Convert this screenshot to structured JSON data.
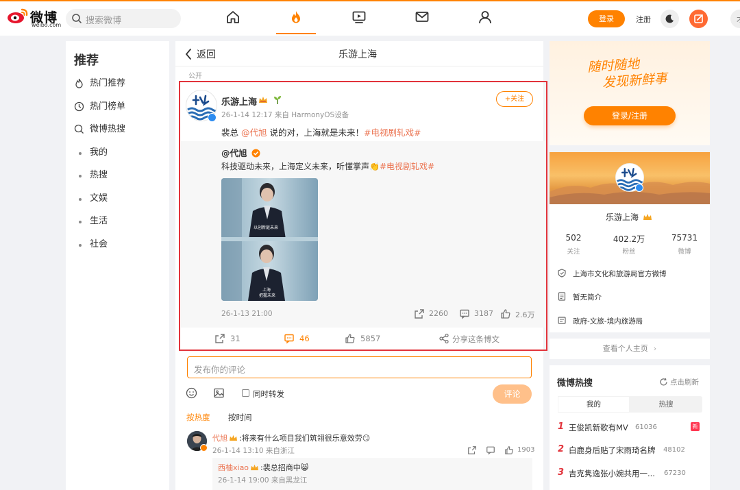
{
  "header": {
    "logo_text": "微博",
    "logo_sub": "weibo.com",
    "search_placeholder": "搜索微博",
    "nav": [
      "home-icon",
      "hot-icon",
      "video-icon",
      "message-icon",
      "profile-icon"
    ],
    "login_label": "登录",
    "register_label": "注册",
    "extra_label": "才"
  },
  "sidebar": {
    "title": "推荐",
    "items": [
      {
        "label": "热门推荐",
        "icon": "flame-icon"
      },
      {
        "label": "热门榜单",
        "icon": "clock-icon"
      },
      {
        "label": "微博热搜",
        "icon": "search-icon"
      },
      {
        "label": "我的"
      },
      {
        "label": "热搜"
      },
      {
        "label": "文娱"
      },
      {
        "label": "生活"
      },
      {
        "label": "社会"
      }
    ]
  },
  "main": {
    "back_label": "返回",
    "title": "乐游上海",
    "visibility": "公开",
    "post": {
      "author": "乐游上海",
      "meta": "26-1-14 12:17 来自 HarmonyOS设备",
      "follow_label": "+关注",
      "text_pre": "裴总 ",
      "text_mention": "@代旭",
      "text_mid": " 说的对，上海就是未来！",
      "text_topic": "#电视剧轧戏#",
      "repost": {
        "author": "@代旭",
        "text": "科技驱动未来，上海定义未来，听懂掌声👏",
        "topic": "#电视剧轧戏#",
        "time": "26-1-13 21:00",
        "reposts": "2260",
        "comments": "3187",
        "likes": "2.6万",
        "video_caption_1": "以创新驱未来",
        "video_caption_2": "上海",
        "video_caption_3": "把握未来"
      },
      "reposts": "31",
      "comments": "46",
      "likes": "5857",
      "share_label": "分享这条博文"
    },
    "comment_box": {
      "placeholder": "发布你的评论",
      "forward_label": "同时转发",
      "submit_label": "评论"
    },
    "sort": {
      "hot": "按热度",
      "time": "按时间"
    },
    "comments": [
      {
        "user": "代旭",
        "text": ":将来有什么项目我们筑翎很乐意效劳😏",
        "meta": "26-1-14 13:10 来自浙江",
        "likes": "1903",
        "reply": {
          "user": "西柚xiao",
          "text": ":裴总招商中😸",
          "meta": "26-1-14 19:00 来自黑龙江"
        }
      }
    ]
  },
  "right": {
    "slogan_line1": "随时随地",
    "slogan_line2": "发现新鲜事",
    "login_register": "登录/注册",
    "profile": {
      "name": "乐游上海",
      "stats": [
        {
          "value": "502",
          "label": "关注"
        },
        {
          "value": "402.2万",
          "label": "粉丝"
        },
        {
          "value": "75731",
          "label": "微博"
        }
      ],
      "info": [
        {
          "text": "上海市文化和旅游局官方微博",
          "icon": "shield-icon"
        },
        {
          "text": "暂无简介",
          "icon": "document-icon"
        },
        {
          "text": "政府-文旅-境内旅游局",
          "icon": "tag-icon"
        }
      ],
      "view_label": "查看个人主页",
      "view_chevron": "›"
    },
    "hot_search": {
      "title": "微博热搜",
      "refresh_label": "点击刷新",
      "tabs": [
        "我的",
        "热搜"
      ],
      "new_badge": "新",
      "items": [
        {
          "rank": "1",
          "text": "王俊凯新歌有MV",
          "count": "61036"
        },
        {
          "rank": "2",
          "text": "白鹿身后贴了宋雨琦名牌",
          "count": "48102"
        },
        {
          "rank": "3",
          "text": "吉克隽逸张小婉共用一...",
          "count": "67230"
        }
      ]
    }
  },
  "colors": {
    "brand": "#ff8200",
    "highlight_frame": "#e2333b",
    "link": "#eb7350"
  }
}
